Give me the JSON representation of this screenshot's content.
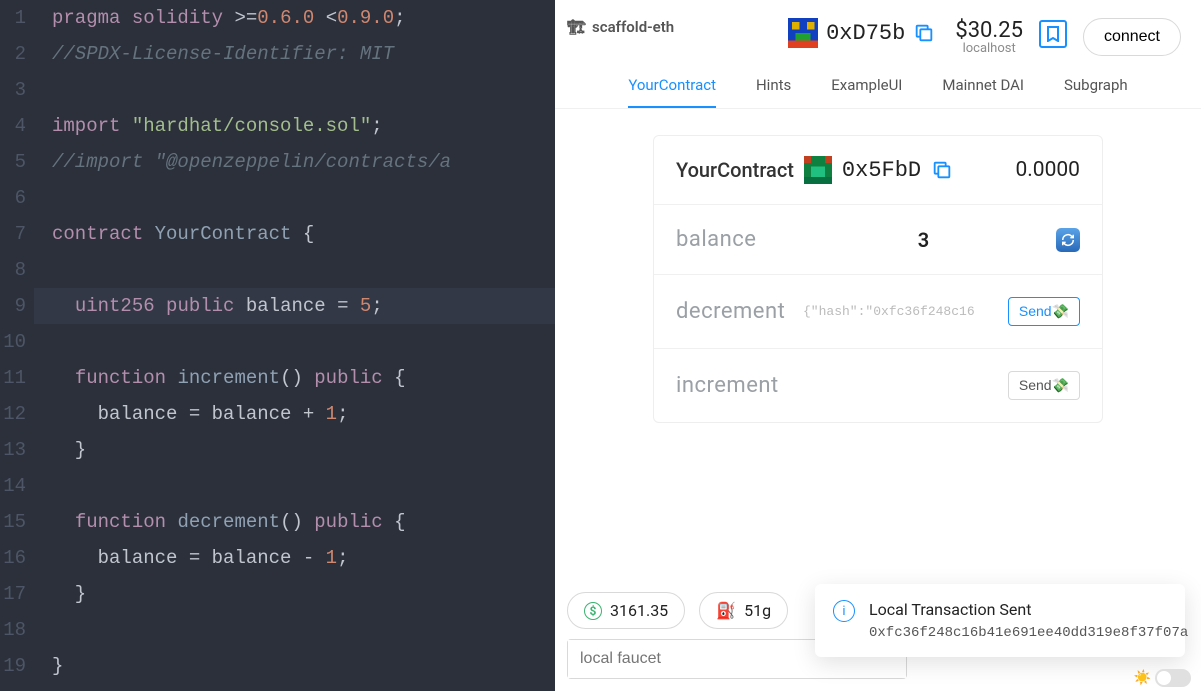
{
  "editor": {
    "lines": [
      {
        "n": "1",
        "html": "<span class='tok-type'>pragma</span> <span class='tok-type'>solidity</span> <span class='tok-op'>&gt;=</span><span class='tok-num'>0.6.0</span> <span class='tok-op'>&lt;</span><span class='tok-num'>0.9.0</span>;"
      },
      {
        "n": "2",
        "html": "<span class='tok-cmt'>//SPDX-License-Identifier: MIT</span>"
      },
      {
        "n": "3",
        "html": ""
      },
      {
        "n": "4",
        "html": "<span class='tok-kw'>import</span> <span class='tok-str'>\"hardhat/console.sol\"</span>;"
      },
      {
        "n": "5",
        "html": "<span class='tok-cmt'>//import \"@openzeppelin/contracts/a</span>"
      },
      {
        "n": "6",
        "html": ""
      },
      {
        "n": "7",
        "html": "<span class='tok-kw'>contract</span> <span class='tok-fn'>YourContract</span> {"
      },
      {
        "n": "8",
        "html": ""
      },
      {
        "n": "9",
        "hl": true,
        "html": "  <span class='tok-type'>uint256</span> <span class='tok-kw'>public</span> balance <span class='tok-op'>=</span> <span class='tok-num'>5</span>;"
      },
      {
        "n": "10",
        "html": ""
      },
      {
        "n": "11",
        "html": "  <span class='tok-kw'>function</span> <span class='tok-fn'>increment</span>() <span class='tok-kw'>public</span> {"
      },
      {
        "n": "12",
        "html": "    balance <span class='tok-op'>=</span> balance <span class='tok-op'>+</span> <span class='tok-num'>1</span>;"
      },
      {
        "n": "13",
        "html": "  }"
      },
      {
        "n": "14",
        "html": ""
      },
      {
        "n": "15",
        "html": "  <span class='tok-kw'>function</span> <span class='tok-fn'>decrement</span>() <span class='tok-kw'>public</span> {"
      },
      {
        "n": "16",
        "html": "    balance <span class='tok-op'>=</span> balance <span class='tok-op'>-</span> <span class='tok-num'>1</span>;"
      },
      {
        "n": "17",
        "html": "  }"
      },
      {
        "n": "18",
        "html": ""
      },
      {
        "n": "19",
        "html": "}"
      }
    ]
  },
  "brand": {
    "crane_icon": "🏗",
    "name": "scaffold-eth"
  },
  "header": {
    "wallet_address_short": "0xD75b",
    "balance_display": "$30.25",
    "host": "localhost",
    "connect_label": "connect",
    "bookmark_icon": "bookmark"
  },
  "tabs": [
    {
      "label": "YourContract",
      "active": true
    },
    {
      "label": "Hints"
    },
    {
      "label": "ExampleUI"
    },
    {
      "label": "Mainnet DAI"
    },
    {
      "label": "Subgraph"
    }
  ],
  "card": {
    "title": "YourContract",
    "contract_address_short": "0x5FbD",
    "contract_balance": "0.0000",
    "rows": {
      "balance": {
        "label": "balance",
        "value": "3"
      },
      "decrement": {
        "label": "decrement",
        "hash_preview": "{\"hash\":\"0xfc36f248c16",
        "send_label": "Send💸"
      },
      "increment": {
        "label": "increment",
        "send_label": "Send💸"
      }
    }
  },
  "bottom": {
    "eth_balance": "3161.35",
    "gas": "51g",
    "fuel_icon": "⛽",
    "faucet_placeholder": "local faucet"
  },
  "toast": {
    "title": "Local Transaction Sent",
    "hash": "0xfc36f248c16b41e691ee40dd319e8f37f07a"
  },
  "theme": {
    "sun": "☀️"
  }
}
